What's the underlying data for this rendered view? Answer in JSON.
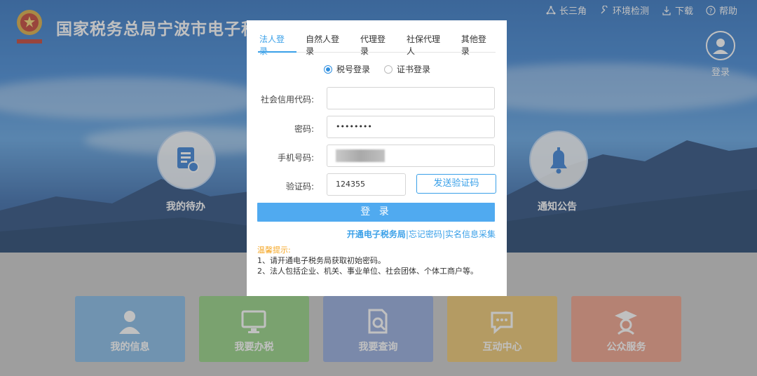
{
  "site": {
    "title": "国家税务总局宁波市电子税务局"
  },
  "topnav": [
    {
      "icon": "network-icon",
      "label": "长三角"
    },
    {
      "icon": "wrench-icon",
      "label": "环境检测"
    },
    {
      "icon": "download-icon",
      "label": "下载"
    },
    {
      "icon": "help-icon",
      "label": "帮助"
    }
  ],
  "header_login": {
    "label": "登录"
  },
  "shortcuts": {
    "todo": "我的待办",
    "notice": "通知公告"
  },
  "tiles": [
    {
      "label": "我的信息",
      "color": "#7fb7e6"
    },
    {
      "label": "我要办税",
      "color": "#8fcf7c"
    },
    {
      "label": "我要查询",
      "color": "#8ea7dc"
    },
    {
      "label": "互动中心",
      "color": "#ecc46a"
    },
    {
      "label": "公众服务",
      "color": "#ee9c84"
    }
  ],
  "modal": {
    "tabs": [
      "法人登录",
      "自然人登录",
      "代理登录",
      "社保代理人",
      "其他登录"
    ],
    "active_tab": 0,
    "radios": [
      {
        "label": "税号登录",
        "checked": true
      },
      {
        "label": "证书登录",
        "checked": false
      }
    ],
    "fields": {
      "credit_code": {
        "label": "社会信用代码:",
        "value": ""
      },
      "password": {
        "label": "密码:",
        "value": "••••••••"
      },
      "phone": {
        "label": "手机号码:",
        "value": ""
      },
      "captcha": {
        "label": "验证码:",
        "value": "124355"
      }
    },
    "send_code": "发送验证码",
    "login_button": "登 录",
    "links": {
      "open": "开通电子税务局",
      "sep1": "|",
      "forgot": "忘记密码",
      "sep2": "|",
      "realname": "实名信息采集"
    },
    "tips": {
      "title": "温馨提示:",
      "line1": "1、请开通电子税务局获取初始密码。",
      "line2": "2、法人包括企业、机关、事业单位、社会团体、个体工商户等。"
    }
  },
  "colors": {
    "accent": "#3aa0e8",
    "login_button": "#50aaf0",
    "tips_title": "#f5a623"
  }
}
